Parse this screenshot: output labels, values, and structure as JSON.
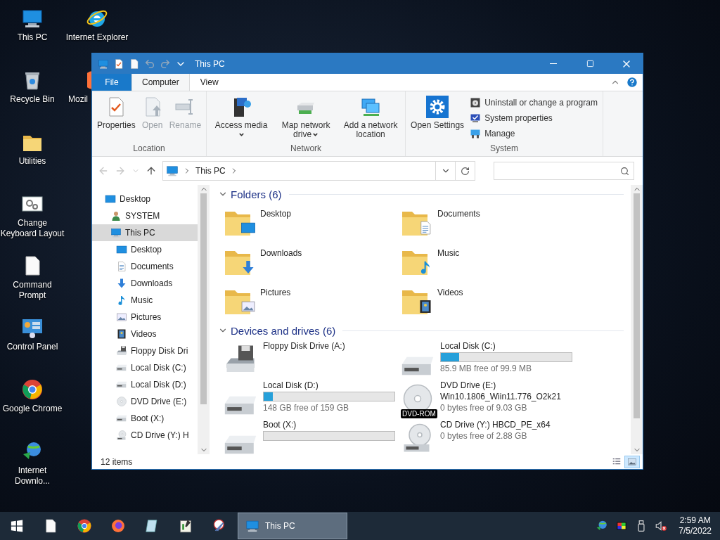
{
  "desktop_icons": [
    {
      "label": "This PC",
      "kind": "pc"
    },
    {
      "label": "Recycle Bin",
      "kind": "recycle"
    },
    {
      "label": "Utilities",
      "kind": "folder"
    },
    {
      "label": "Change Keyboard Layout",
      "kind": "gears"
    },
    {
      "label": "Command Prompt",
      "kind": "file"
    },
    {
      "label": "Control Panel",
      "kind": "control"
    },
    {
      "label": "Google Chrome",
      "kind": "chrome"
    },
    {
      "label": "Internet Downlo...",
      "kind": "idm"
    },
    {
      "label": "Internet Explorer",
      "kind": "ie"
    },
    {
      "label": "Mozil",
      "kind": "firefox",
      "covered": true
    }
  ],
  "window": {
    "title": "This PC",
    "quick_access": [
      {
        "kind": "pc"
      },
      {
        "kind": "properties"
      },
      {
        "kind": "file"
      },
      {
        "kind": "undo"
      },
      {
        "kind": "redo"
      },
      {
        "kind": "caret"
      }
    ],
    "ribbon_tabs": [
      {
        "label": "File",
        "kind": "file-menu",
        "selected": false
      },
      {
        "label": "Computer",
        "kind": "tab",
        "selected": true
      },
      {
        "label": "View",
        "kind": "tab",
        "selected": false
      }
    ],
    "ribbon_groups": [
      {
        "label": "Location",
        "large": [
          {
            "label": "Properties",
            "kind": "properties",
            "disabled": false,
            "dropdown": false
          },
          {
            "label": "Open",
            "kind": "open",
            "disabled": true,
            "dropdown": false
          },
          {
            "label": "Rename",
            "kind": "rename",
            "disabled": true,
            "dropdown": false
          }
        ]
      },
      {
        "label": "Network",
        "large": [
          {
            "label": "Access media",
            "kind": "media",
            "disabled": false,
            "dropdown": true
          },
          {
            "label": "Map network drive",
            "kind": "netdrive",
            "disabled": false,
            "dropdown": true
          },
          {
            "label": "Add a network location",
            "kind": "netloc",
            "disabled": false,
            "dropdown": false
          }
        ]
      },
      {
        "label": "System",
        "large": [
          {
            "label": "Open Settings",
            "kind": "gear",
            "disabled": false,
            "dropdown": false
          }
        ],
        "small": [
          {
            "label": "Uninstall or change a program",
            "kind": "uninstall"
          },
          {
            "label": "System properties",
            "kind": "sysprops"
          },
          {
            "label": "Manage",
            "kind": "manage"
          }
        ]
      }
    ],
    "address": {
      "crumbs": [
        "This PC"
      ]
    },
    "nav_tree": [
      {
        "label": "Desktop",
        "kind": "desktop",
        "selected": false,
        "children": [
          {
            "label": "SYSTEM",
            "kind": "user",
            "selected": false
          },
          {
            "label": "This PC",
            "kind": "pc",
            "selected": true,
            "children": [
              {
                "label": "Desktop",
                "kind": "desktop",
                "selected": false
              },
              {
                "label": "Documents",
                "kind": "documents",
                "selected": false
              },
              {
                "label": "Downloads",
                "kind": "downloads",
                "selected": false
              },
              {
                "label": "Music",
                "kind": "music",
                "selected": false
              },
              {
                "label": "Pictures",
                "kind": "pictures",
                "selected": false
              },
              {
                "label": "Videos",
                "kind": "videos",
                "selected": false
              },
              {
                "label": "Floppy Disk Dri",
                "kind": "floppy",
                "selected": false
              },
              {
                "label": "Local Disk (C:)",
                "kind": "disk",
                "selected": false
              },
              {
                "label": "Local Disk (D:)",
                "kind": "disk",
                "selected": false
              },
              {
                "label": "DVD Drive (E:)",
                "kind": "dvd",
                "selected": false
              },
              {
                "label": "Boot (X:)",
                "kind": "disk",
                "selected": false
              },
              {
                "label": "CD Drive (Y:) H",
                "kind": "cd",
                "selected": false
              }
            ]
          }
        ]
      }
    ],
    "folders": {
      "title": "Folders (6)",
      "expanded": true,
      "items": [
        {
          "label": "Desktop",
          "kind": "desktop"
        },
        {
          "label": "Documents",
          "kind": "documents"
        },
        {
          "label": "Downloads",
          "kind": "downloads"
        },
        {
          "label": "Music",
          "kind": "music"
        },
        {
          "label": "Pictures",
          "kind": "pictures"
        },
        {
          "label": "Videos",
          "kind": "videos"
        }
      ]
    },
    "drives": {
      "title": "Devices and drives (6)",
      "expanded": true,
      "items": [
        {
          "name": "Floppy Disk Drive (A:)",
          "kind": "floppy"
        },
        {
          "name": "Local Disk (C:)",
          "kind": "disk",
          "level": 0.14,
          "free": "85.9 MB free of 99.9 MB"
        },
        {
          "name": "Local Disk (D:)",
          "kind": "disk",
          "level": 0.07,
          "free": "148 GB free of 159 GB"
        },
        {
          "name": "DVD Drive (E:)",
          "kind": "dvd",
          "volume": "Win10.1806_Wiin11.776_O2k21",
          "free": "0 bytes free of 9.03 GB",
          "badge": "DVD-ROM"
        },
        {
          "name": "Boot (X:)",
          "kind": "disk",
          "level": 0
        },
        {
          "name": "CD Drive (Y:) HBCD_PE_x64",
          "kind": "cd",
          "free": "0 bytes free of 2.88 GB"
        }
      ]
    },
    "status_bar": {
      "count": "12 items",
      "views": [
        {
          "kind": "details",
          "selected": false
        },
        {
          "kind": "large",
          "selected": true
        }
      ]
    }
  },
  "taskbar": {
    "pinned": [
      {
        "kind": "file"
      },
      {
        "kind": "chrome"
      },
      {
        "kind": "firefox"
      },
      {
        "kind": "tablet"
      },
      {
        "kind": "notepad"
      },
      {
        "kind": "scissors"
      }
    ],
    "windows": [
      {
        "label": "This PC",
        "kind": "pc",
        "selected": true
      }
    ],
    "tray": [
      {
        "kind": "idm"
      },
      {
        "kind": "colors"
      },
      {
        "kind": "usb"
      },
      {
        "kind": "muted"
      }
    ],
    "time": "2:59 AM",
    "date": "7/5/2022"
  }
}
